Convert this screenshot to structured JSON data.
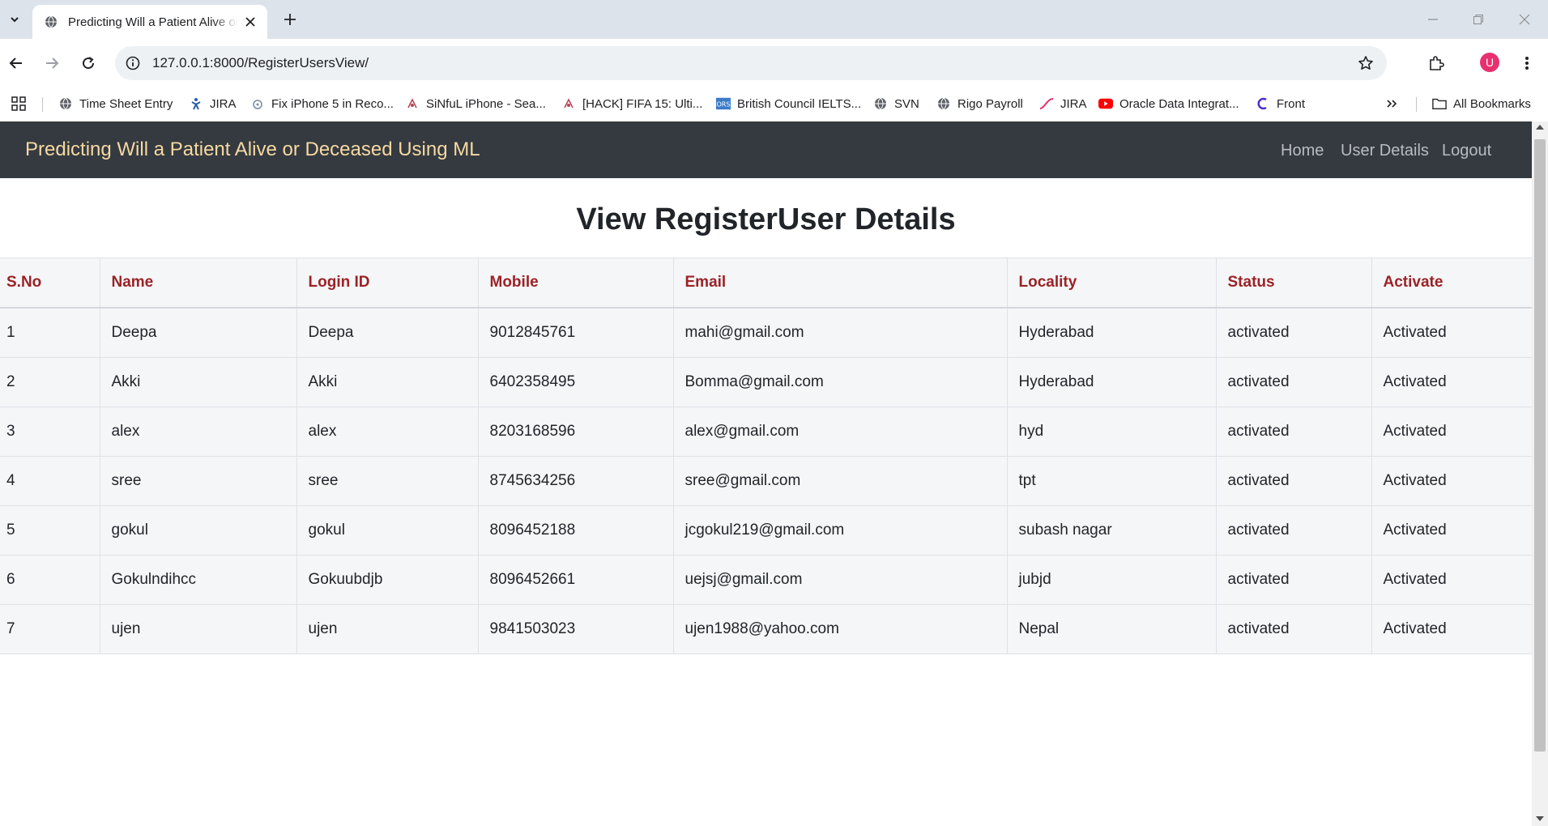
{
  "browser": {
    "tab_title": "Predicting Will a Patient Alive or Deceased Using ML",
    "url": "127.0.0.1:8000/RegisterUsersView/",
    "avatar_letter": "U",
    "bookmarks": [
      {
        "label": "Time Sheet Entry",
        "icon": "globe-icon"
      },
      {
        "label": "JIRA",
        "icon": "jira-icon"
      },
      {
        "label": "Fix iPhone 5 in Reco...",
        "icon": "phone-icon"
      },
      {
        "label": "SiNfuL iPhone - Sea...",
        "icon": "phone-icon"
      },
      {
        "label": "[HACK] FIFA 15: Ulti...",
        "icon": "game-icon"
      },
      {
        "label": "British Council IELTS...",
        "icon": "ors-icon"
      },
      {
        "label": "SVN",
        "icon": "globe-icon"
      },
      {
        "label": "Rigo Payroll",
        "icon": "globe-icon"
      },
      {
        "label": "JIRA",
        "icon": "jira-icon"
      },
      {
        "label": "Oracle Data Integrat...",
        "icon": "youtube-icon"
      },
      {
        "label": "Front",
        "icon": "front-icon"
      }
    ],
    "all_bookmarks_label": "All Bookmarks"
  },
  "navbar": {
    "brand": "Predicting Will a Patient Alive or Deceased Using ML",
    "links": [
      "Home",
      "User Details",
      "Logout"
    ]
  },
  "page": {
    "title": "View RegisterUser Details"
  },
  "table": {
    "headers": [
      "S.No",
      "Name",
      "Login ID",
      "Mobile",
      "Email",
      "Locality",
      "Status",
      "Activate"
    ],
    "rows": [
      [
        "1",
        "Deepa",
        "Deepa",
        "9012845761",
        "mahi@gmail.com",
        "Hyderabad",
        "activated",
        "Activated"
      ],
      [
        "2",
        "Akki",
        "Akki",
        "6402358495",
        "Bomma@gmail.com",
        "Hyderabad",
        "activated",
        "Activated"
      ],
      [
        "3",
        "alex",
        "alex",
        "8203168596",
        "alex@gmail.com",
        "hyd",
        "activated",
        "Activated"
      ],
      [
        "4",
        "sree",
        "sree",
        "8745634256",
        "sree@gmail.com",
        "tpt",
        "activated",
        "Activated"
      ],
      [
        "5",
        "gokul",
        "gokul",
        "8096452188",
        "jcgokul219@gmail.com",
        "subash nagar",
        "activated",
        "Activated"
      ],
      [
        "6",
        "Gokulndihcc",
        "Gokuubdjb",
        "8096452661",
        "uejsj@gmail.com",
        "jubjd",
        "activated",
        "Activated"
      ],
      [
        "7",
        "ujen",
        "ujen",
        "9841503023",
        "ujen1988@yahoo.com",
        "Nepal",
        "activated",
        "Activated"
      ]
    ]
  },
  "colors": {
    "navbar_bg": "#343a40",
    "brand": "#f7d9a2",
    "header_text": "#9b2226",
    "table_bg": "#f5f6f8"
  }
}
